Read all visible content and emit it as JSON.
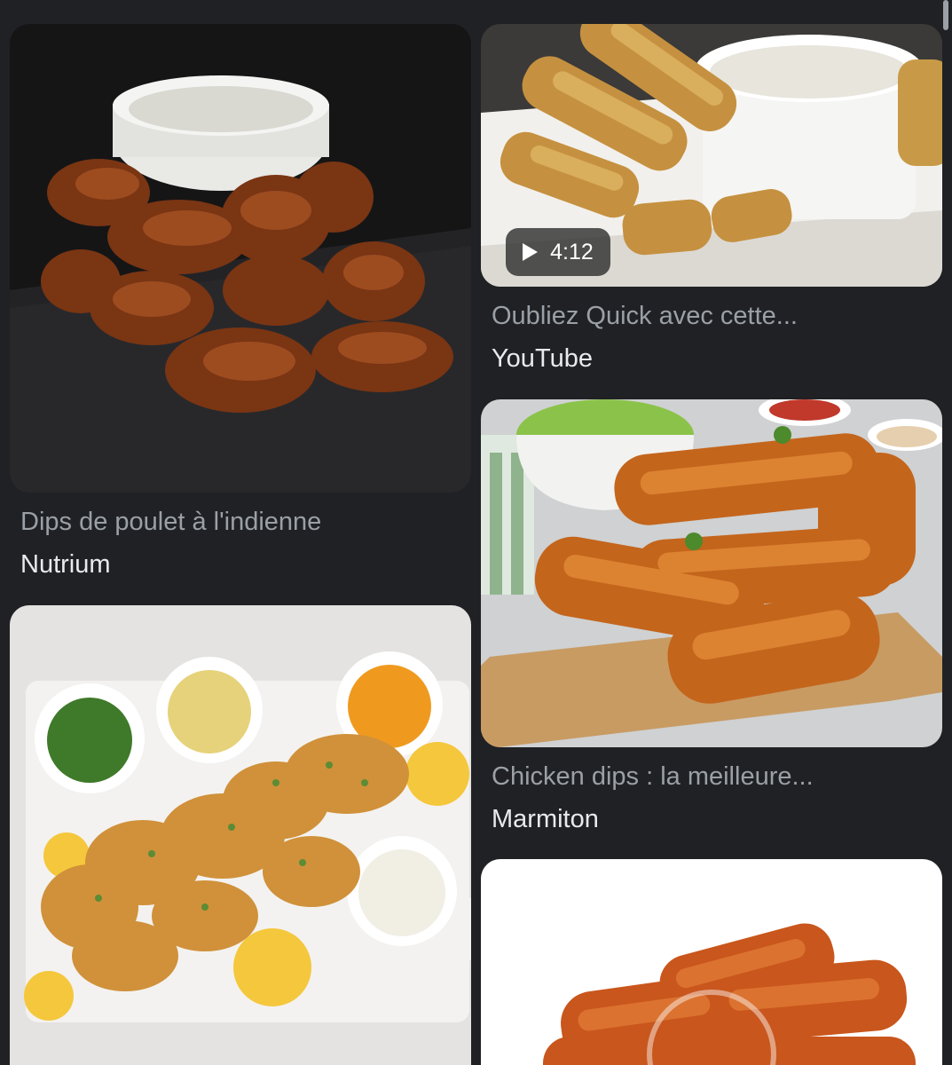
{
  "results": [
    {
      "title": "Dips de poulet à l'indienne",
      "source": "Nutrium",
      "image": "fried-chicken-nuggets-on-slate-with-dip"
    },
    {
      "title": "Oubliez Quick avec cette...",
      "source": "YouTube",
      "image": "breaded-chicken-strips-with-white-sauce",
      "video_duration": "4:12",
      "video_icon": "play-icon"
    },
    {
      "title": "",
      "source": "",
      "image": "fried-chicken-pieces-on-marble-board-with-dips"
    },
    {
      "title": "Chicken dips : la meilleure...",
      "source": "Marmiton",
      "image": "crispy-chicken-tenders-on-wooden-board"
    },
    {
      "title": "",
      "source": "",
      "image": "chicken-tenders-on-white-background"
    }
  ]
}
